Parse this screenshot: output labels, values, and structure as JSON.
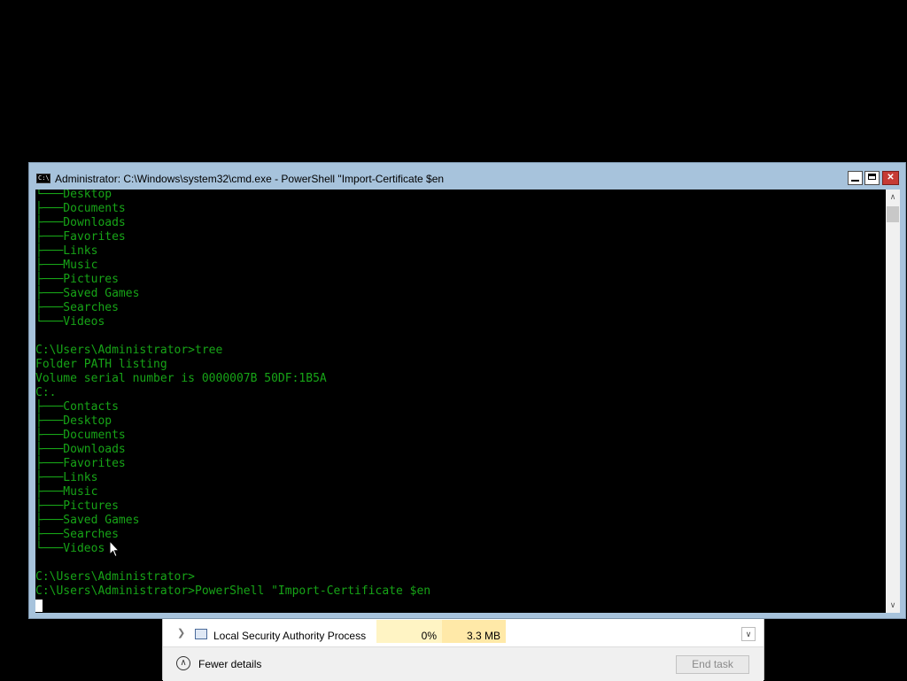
{
  "taskmgr": {
    "process_row": {
      "name": "Local Security Authority Process",
      "cpu": "0%",
      "memory": "3.3 MB"
    },
    "footer": {
      "fewer_details": "Fewer details",
      "end_task": "End task"
    }
  },
  "console": {
    "title": "Administrator: C:\\Windows\\system32\\cmd.exe - PowerShell  \"Import-Certificate $en",
    "lines": [
      "└───Desktop",
      "├───Documents",
      "├───Downloads",
      "├───Favorites",
      "├───Links",
      "├───Music",
      "├───Pictures",
      "├───Saved Games",
      "├───Searches",
      "└───Videos",
      "",
      "C:\\Users\\Administrator>tree",
      "Folder PATH listing",
      "Volume serial number is 0000007B 50DF:1B5A",
      "C:.",
      "├───Contacts",
      "├───Desktop",
      "├───Documents",
      "├───Downloads",
      "├───Favorites",
      "├───Links",
      "├───Music",
      "├───Pictures",
      "├───Saved Games",
      "├───Searches",
      "└───Videos",
      "",
      "C:\\Users\\Administrator>",
      "C:\\Users\\Administrator>PowerShell \"Import-Certificate $en"
    ]
  },
  "colors": {
    "console_text": "#17a417",
    "title_bar": "#a7c3dc",
    "close_button": "#c63b35"
  }
}
